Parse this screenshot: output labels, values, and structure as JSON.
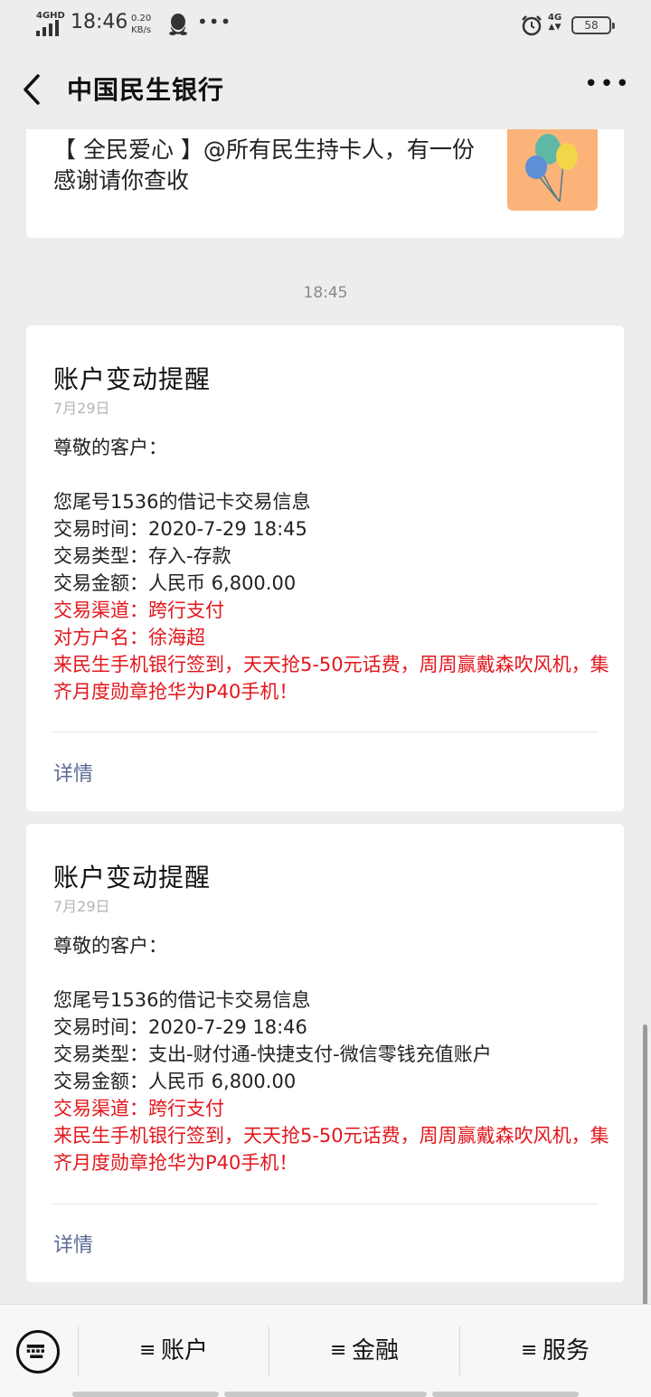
{
  "status_bar": {
    "network_label": "4GHD",
    "time": "18:46",
    "speed_value": "0.20",
    "speed_unit": "KB/s",
    "dots": "•••",
    "net_type": "4G",
    "battery": "58"
  },
  "header": {
    "title": "中国民生银行",
    "more": "•••"
  },
  "promo": {
    "text": "【 全民爱心 】@所有民生持卡人，有一份感谢请你查收"
  },
  "timestamp": "18:45",
  "notices": [
    {
      "title": "账户变动提醒",
      "date": "7月29日",
      "greeting": "尊敬的客户：",
      "lines": [
        "您尾号1536的借记卡交易信息",
        "交易时间：2020-7-29 18:45",
        "交易类型：存入-存款",
        "交易金额：人民币 6,800.00"
      ],
      "red_lines": [
        "交易渠道：跨行支付",
        "对方户名：徐海超"
      ],
      "promo_line": "来民生手机银行签到，天天抢5-50元话费，周周赢戴森吹风机，集齐月度勋章抢华为P40手机！",
      "details": "详情"
    },
    {
      "title": "账户变动提醒",
      "date": "7月29日",
      "greeting": "尊敬的客户：",
      "lines": [
        "您尾号1536的借记卡交易信息",
        "交易时间：2020-7-29 18:46",
        "交易类型：支出-财付通-快捷支付-微信零钱充值账户",
        "交易金额：人民币 6,800.00"
      ],
      "red_lines": [
        "交易渠道：跨行支付"
      ],
      "promo_line": "来民生手机银行签到，天天抢5-50元话费，周周赢戴森吹风机，集齐月度勋章抢华为P40手机！",
      "details": "详情"
    }
  ],
  "tabbar": {
    "tabs": [
      {
        "label": "账户"
      },
      {
        "label": "金融"
      },
      {
        "label": "服务"
      }
    ],
    "menu_glyph": "≡"
  },
  "colors": {
    "background": "#ededed",
    "card": "#ffffff",
    "alert_red": "#e2171d",
    "link_blue": "#5b6b93",
    "promo_orange": "#fbb37a"
  }
}
